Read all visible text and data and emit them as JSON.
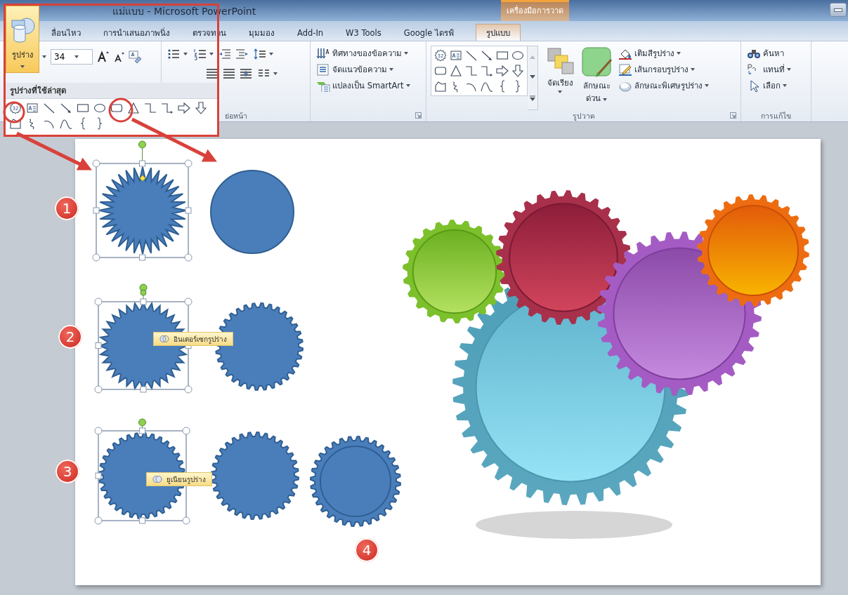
{
  "window": {
    "title": "แม่แบบ - Microsoft PowerPoint",
    "context_group": "เครื่องมือการวาด"
  },
  "tabs": [
    {
      "label": "ลื่อนไหว",
      "selected": false
    },
    {
      "label": "การนำเสนอภาพนิ่ง",
      "selected": false
    },
    {
      "label": "ตรวจทาน",
      "selected": false
    },
    {
      "label": "มุมมอง",
      "selected": false
    },
    {
      "label": "Add-In",
      "selected": false
    },
    {
      "label": "W3 Tools",
      "selected": false
    },
    {
      "label": "Google ไดรฟ์",
      "selected": false
    },
    {
      "label": "รูปแบบ",
      "selected": true
    }
  ],
  "font_group": {
    "font_size": "34"
  },
  "paragraph_group": {
    "label": "ย่อหน้า"
  },
  "text_commands": [
    "ทิศทางของข้อความ",
    "จัดแนวข้อความ",
    "แปลงเป็น SmartArt"
  ],
  "drawing_group": {
    "label": "รูปวาด",
    "gallery": [
      {
        "kind": "star",
        "label": "32"
      },
      {
        "kind": "textbox"
      },
      {
        "kind": "line"
      },
      {
        "kind": "arrowline"
      },
      {
        "kind": "rect"
      },
      {
        "kind": "ellipse"
      },
      {
        "kind": "roundrect"
      },
      {
        "kind": "triangle"
      },
      {
        "kind": "elbow"
      },
      {
        "kind": "elbowarrow"
      },
      {
        "kind": "rightarrow"
      },
      {
        "kind": "downarrow"
      },
      {
        "kind": "freeform"
      },
      {
        "kind": "scribble"
      },
      {
        "kind": "arc"
      },
      {
        "kind": "curve"
      },
      {
        "kind": "lbrace"
      },
      {
        "kind": "rbrace"
      }
    ],
    "arrange": "จัดเรียง",
    "quick_styles": [
      "ลักษณะ",
      "ด่วน"
    ],
    "commands": [
      "เติมสีรูปร่าง",
      "เส้นกรอบรูปร่าง",
      "ลักษณะพิเศษรูปร่าง"
    ]
  },
  "editing_group": {
    "label": "การแก้ไข",
    "commands": [
      "ค้นหา",
      "แทนที่",
      "เลือก"
    ]
  },
  "shapes_dropdown": {
    "button": "รูปร่าง",
    "heading": "รูปร่างที่ใช้ล่าสุด",
    "shapes": [
      {
        "kind": "star",
        "label": "32"
      },
      {
        "kind": "textbox"
      },
      {
        "kind": "line"
      },
      {
        "kind": "arrowline"
      },
      {
        "kind": "rect"
      },
      {
        "kind": "ellipse"
      },
      {
        "kind": "roundrect"
      },
      {
        "kind": "triangle"
      },
      {
        "kind": "elbow"
      },
      {
        "kind": "elbowarrow"
      },
      {
        "kind": "rightarrow"
      },
      {
        "kind": "downarrow"
      },
      {
        "kind": "freeform"
      },
      {
        "kind": "scribble"
      },
      {
        "kind": "arc"
      },
      {
        "kind": "curve"
      },
      {
        "kind": "lbrace"
      },
      {
        "kind": "rbrace"
      }
    ]
  },
  "slide": {
    "steps": [
      "1",
      "2",
      "3",
      "4"
    ],
    "tooltips": [
      "อินเตอร์เซกรูปร่าง",
      "ยูเนียนรูปร่าง"
    ]
  }
}
